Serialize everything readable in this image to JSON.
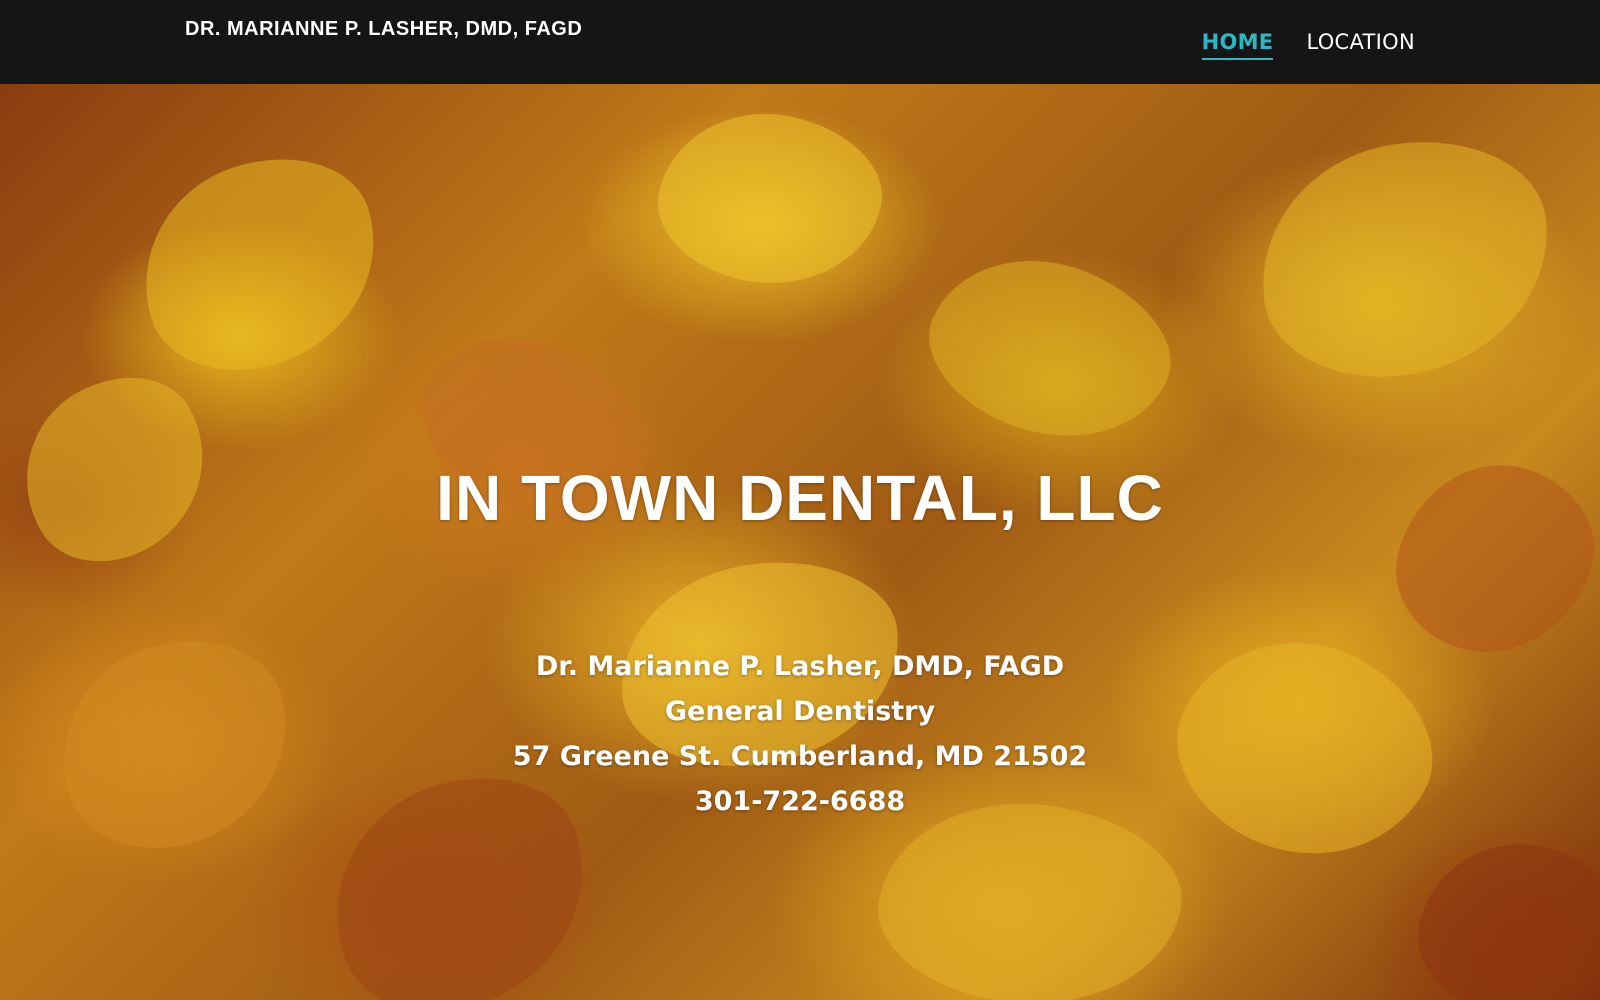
{
  "header": {
    "site_title": "DR. MARIANNE P. LASHER, DMD, FAGD",
    "nav": [
      {
        "label": "HOME",
        "active": true
      },
      {
        "label": "LOCATION",
        "active": false
      }
    ]
  },
  "hero": {
    "title": "IN TOWN DENTAL, LLC",
    "doctor": "Dr. Marianne P. Lasher, DMD, FAGD",
    "specialty": "General Dentistry",
    "address": "57 Greene St. Cumberland, MD 21502",
    "phone": "301-722-6688"
  },
  "colors": {
    "header_bg": "#151516",
    "nav_active": "#2bb8c4",
    "text": "#ffffff"
  }
}
